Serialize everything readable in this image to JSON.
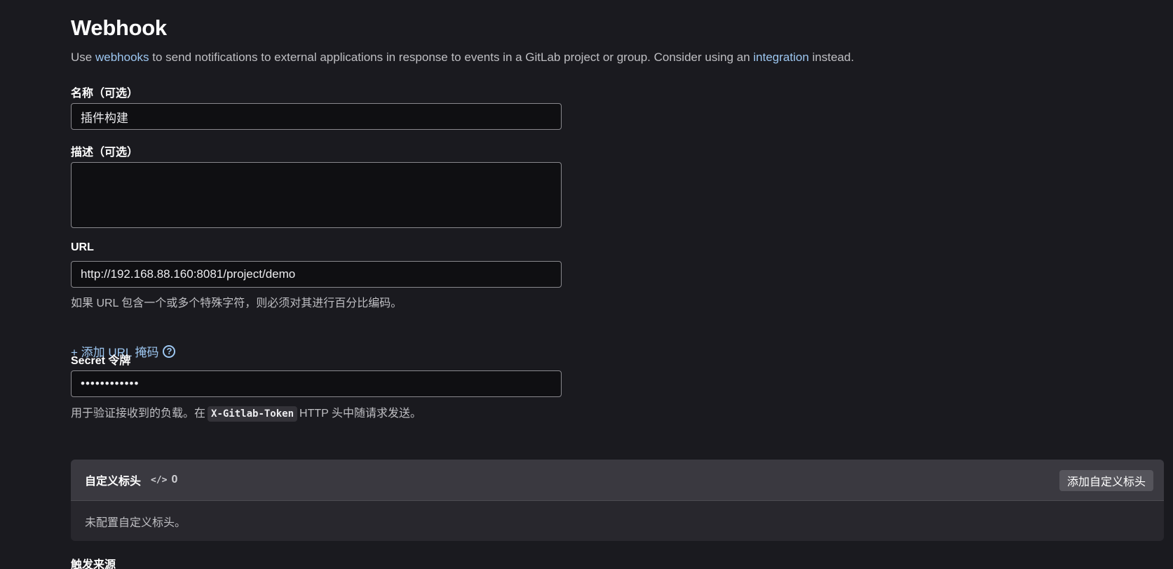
{
  "header": {
    "title": "Webhook",
    "intro_prefix": "Use ",
    "intro_link1": "webhooks",
    "intro_middle": " to send notifications to external applications in response to events in a GitLab project or group. Consider using an ",
    "intro_link2": "integration",
    "intro_suffix": " instead."
  },
  "form": {
    "name_label": "名称（可选）",
    "name_value": "插件构建",
    "description_label": "描述（可选）",
    "description_value": "",
    "url_label": "URL",
    "url_value": "http://192.168.88.160:8081/project/demo",
    "url_help": "如果 URL 包含一个或多个特殊字符，则必须对其进行百分比编码。",
    "add_mask_label": "+ 添加 URL 掩码",
    "secret_label": "Secret 令牌",
    "secret_value": "••••••••••••",
    "secret_help_prefix": "用于验证接收到的负载。在",
    "secret_help_code": "X-Gitlab-Token",
    "secret_help_suffix": "HTTP 头中随请求发送。"
  },
  "custom_headers": {
    "title": "自定义标头",
    "code_icon": "</>",
    "count": "0",
    "add_button": "添加自定义标头",
    "empty_text": "未配置自定义标头。"
  },
  "trigger": {
    "label": "触发来源"
  },
  "colors": {
    "link": "#9dc7f1",
    "background": "#1a1a1f",
    "field_bg": "#0f0f12"
  }
}
